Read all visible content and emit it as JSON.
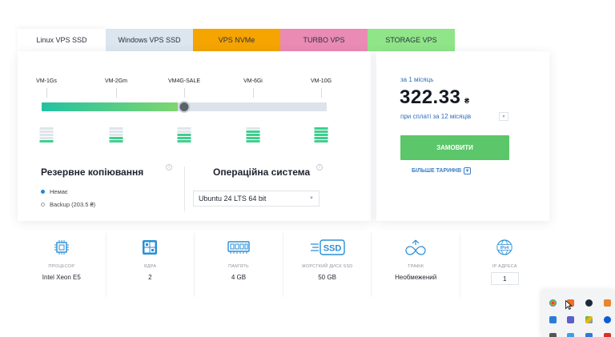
{
  "tabs": [
    {
      "label": "Linux VPS SSD",
      "active": true,
      "color": "#ffffff"
    },
    {
      "label": "Windows VPS SSD",
      "active": false,
      "color": "#dbe6ef"
    },
    {
      "label": "VPS NVMe",
      "active": false,
      "color": "#f5a400"
    },
    {
      "label": "TURBO VPS",
      "active": false,
      "color": "#ea8bb4"
    },
    {
      "label": "STORAGE VPS",
      "active": false,
      "color": "#8fe588"
    }
  ],
  "plans": {
    "labels": [
      "VM-1Gs",
      "VM-2Gm",
      "VM4G-SALE",
      "VM-6Gi",
      "VM-10G"
    ],
    "selected_index": 2,
    "progress": 0.5
  },
  "backup": {
    "title": "Резервне копіювання",
    "options": [
      {
        "label": "Немає",
        "checked": true
      },
      {
        "label": "Backup (203.5 ₴)",
        "checked": false
      }
    ]
  },
  "os": {
    "title": "Операційна система",
    "selected": "Ubuntu 24 LTS 64 bit"
  },
  "pricing": {
    "period_label": "за 1 місяць",
    "price": "322.33",
    "currency": "₴",
    "payment_period": "при сплаті за 12 місяців",
    "order_label": "ЗАМОВИТИ",
    "more_label": "БІЛЬШЕ ТАРИФІВ"
  },
  "specs": [
    {
      "label": "ПРОЦЕСОР",
      "value": "Intel Xeon E5",
      "icon": "cpu-icon"
    },
    {
      "label": "ЯДРА",
      "value": "2",
      "icon": "cores-icon"
    },
    {
      "label": "ПАМ'ЯТЬ",
      "value": "4 GB",
      "icon": "memory-icon"
    },
    {
      "label": "ЖОРСТКИЙ ДИСК SSD",
      "value": "50 GB",
      "icon": "ssd-icon"
    },
    {
      "label": "ТРАФІК",
      "value": "Необмежений",
      "icon": "infinity-icon"
    },
    {
      "label": "IP АДРЕСА",
      "value": "1",
      "icon": "ipv4-icon"
    }
  ],
  "colors": {
    "accent_blue": "#2d6fb8",
    "order_green": "#5cc66a",
    "slider_start": "#22c2a2",
    "slider_end": "#7ed66f",
    "icon_blue": "#2a8fd6"
  }
}
